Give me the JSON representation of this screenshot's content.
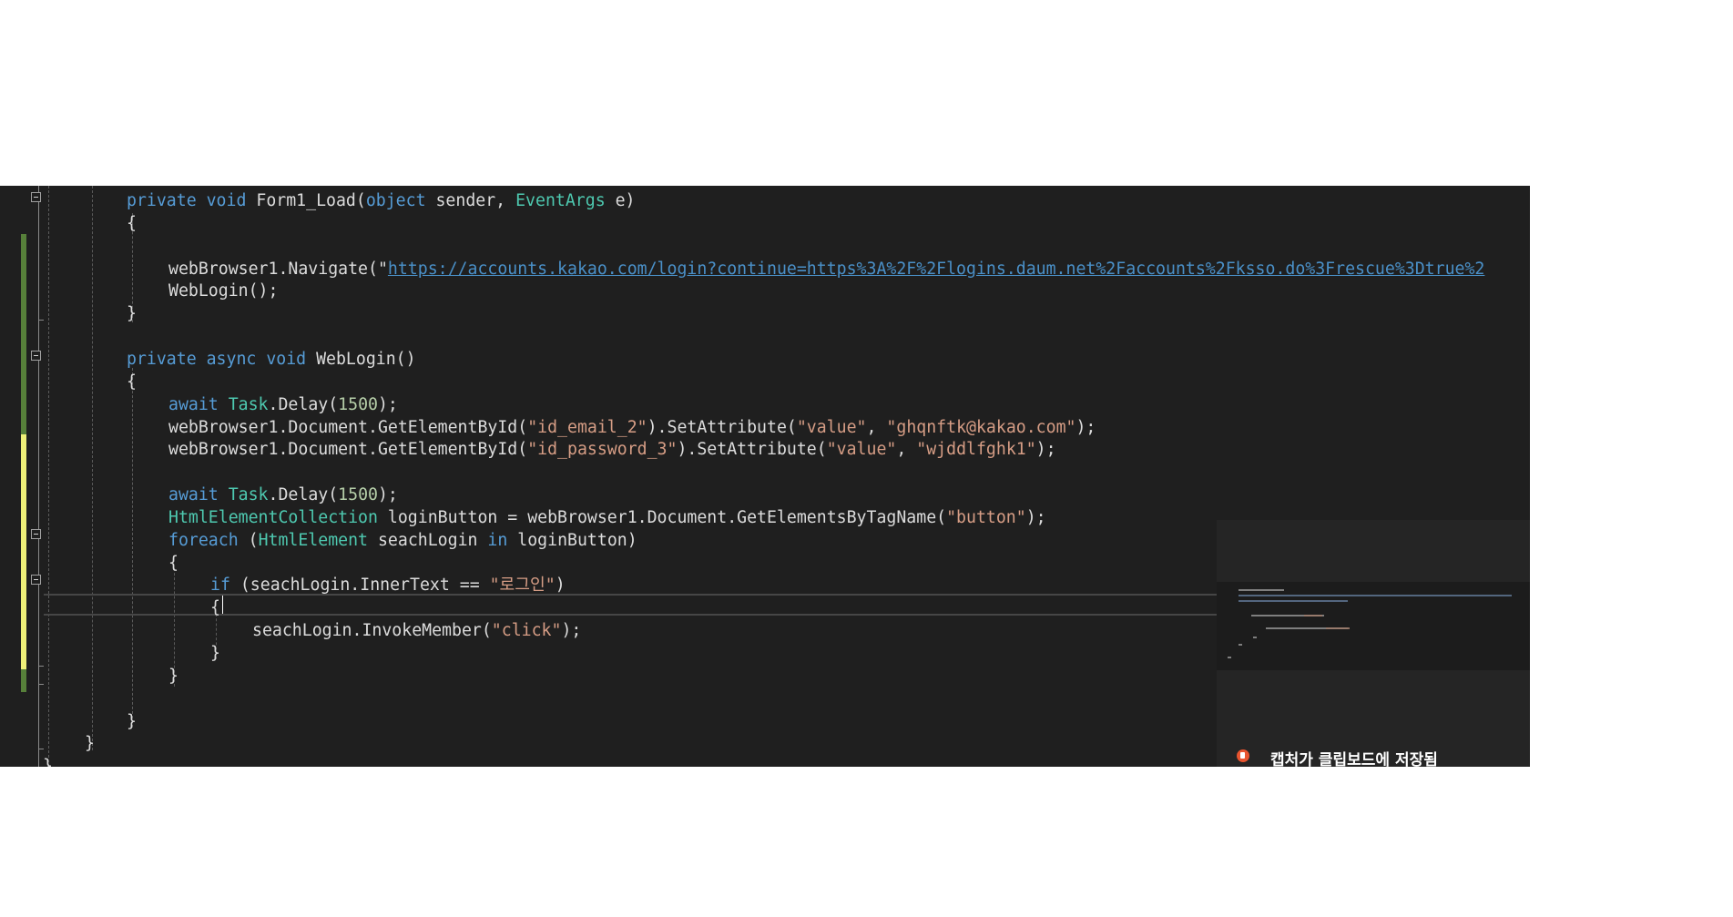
{
  "editor": {
    "lines": [
      [
        {
          "t": "private",
          "c": "kw"
        },
        {
          "t": " "
        },
        {
          "t": "void",
          "c": "kw"
        },
        {
          "t": " Form1_Load("
        },
        {
          "t": "object",
          "c": "kw"
        },
        {
          "t": " sender, "
        },
        {
          "t": "EventArgs",
          "c": "type"
        },
        {
          "t": " e)"
        }
      ],
      [
        {
          "t": "{"
        }
      ],
      [],
      [
        {
          "t": "webBrowser1.Navigate(\""
        },
        {
          "t": "https://accounts.kakao.com/login?continue=https%3A%2F%2Flogins.daum.net%2Faccounts%2Fksso.do%3Frescue%3Dtrue%2",
          "c": "url"
        }
      ],
      [
        {
          "t": "WebLogin();"
        }
      ],
      [
        {
          "t": "}"
        }
      ],
      [],
      [
        {
          "t": "private",
          "c": "kw"
        },
        {
          "t": " "
        },
        {
          "t": "async",
          "c": "kw"
        },
        {
          "t": " "
        },
        {
          "t": "void",
          "c": "kw"
        },
        {
          "t": " WebLogin()"
        }
      ],
      [
        {
          "t": "{"
        }
      ],
      [
        {
          "t": "await",
          "c": "kw"
        },
        {
          "t": " "
        },
        {
          "t": "Task",
          "c": "type"
        },
        {
          "t": ".Delay("
        },
        {
          "t": "1500",
          "c": "num"
        },
        {
          "t": ");"
        }
      ],
      [
        {
          "t": "webBrowser1.Document.GetElementById("
        },
        {
          "t": "\"id_email_2\"",
          "c": "str"
        },
        {
          "t": ").SetAttribute("
        },
        {
          "t": "\"value\"",
          "c": "str"
        },
        {
          "t": ", "
        },
        {
          "t": "\"ghqnftk@kakao.com\"",
          "c": "str"
        },
        {
          "t": ");"
        }
      ],
      [
        {
          "t": "webBrowser1.Document.GetElementById("
        },
        {
          "t": "\"id_password_3\"",
          "c": "str"
        },
        {
          "t": ").SetAttribute("
        },
        {
          "t": "\"value\"",
          "c": "str"
        },
        {
          "t": ", "
        },
        {
          "t": "\"wjddlfghk1\"",
          "c": "str"
        },
        {
          "t": ");"
        }
      ],
      [],
      [
        {
          "t": "await",
          "c": "kw"
        },
        {
          "t": " "
        },
        {
          "t": "Task",
          "c": "type"
        },
        {
          "t": ".Delay("
        },
        {
          "t": "1500",
          "c": "num"
        },
        {
          "t": ");"
        }
      ],
      [
        {
          "t": "HtmlElementCollection",
          "c": "type"
        },
        {
          "t": " loginButton = webBrowser1.Document.GetElementsByTagName("
        },
        {
          "t": "\"button\"",
          "c": "str"
        },
        {
          "t": ");"
        }
      ],
      [
        {
          "t": "foreach",
          "c": "kw"
        },
        {
          "t": " ("
        },
        {
          "t": "HtmlElement",
          "c": "type"
        },
        {
          "t": " seachLogin "
        },
        {
          "t": "in",
          "c": "kw"
        },
        {
          "t": " loginButton)"
        }
      ],
      [
        {
          "t": "{"
        }
      ],
      [
        {
          "t": "if",
          "c": "kw"
        },
        {
          "t": " (seachLogin.InnerText == "
        },
        {
          "t": "\"로그인\"",
          "c": "str"
        },
        {
          "t": ")"
        }
      ],
      [
        {
          "t": "{"
        }
      ],
      [
        {
          "t": "seachLogin.InvokeMember("
        },
        {
          "t": "\"click\"",
          "c": "str"
        },
        {
          "t": ");"
        }
      ],
      [
        {
          "t": "}"
        }
      ],
      [
        {
          "t": "}"
        }
      ],
      [],
      [
        {
          "t": "}"
        }
      ],
      [
        {
          "t": "}"
        }
      ],
      [
        {
          "t": "}"
        }
      ]
    ]
  },
  "notification": {
    "title": "캡처가 클립보드에 저장됨"
  }
}
